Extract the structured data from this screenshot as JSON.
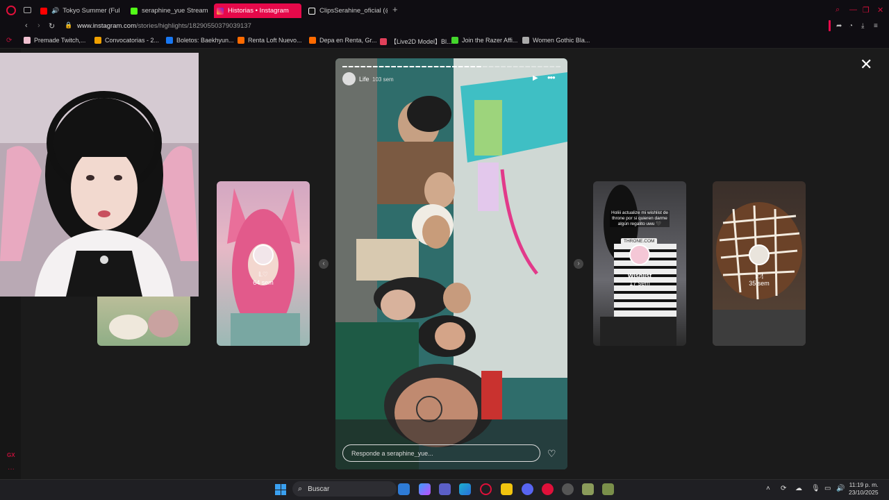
{
  "browser": {
    "tabs": [
      {
        "label": "Tokyo Summer (Full A",
        "active": false,
        "icon": "youtube-icon",
        "icon_color": "#ff0000"
      },
      {
        "label": "seraphine_yue Stream - W",
        "active": false,
        "icon": "kick-icon",
        "icon_color": "#53fc18"
      },
      {
        "label": "Historias • Instagram",
        "active": true,
        "icon": "instagram-icon",
        "icon_color": "#e1306c"
      },
      {
        "label": "ClipsSerahine_oficial (@c",
        "active": false,
        "icon": "tiktok-icon",
        "icon_color": "#ffffff"
      }
    ],
    "new_tab": "+",
    "url_host": "www.instagram.com",
    "url_path": "/stories/highlights/18290550379039137",
    "bookmarks": [
      {
        "label": "Premade Twitch,...",
        "icon_color": "#f0c0d0"
      },
      {
        "label": "Convocatorias - 2...",
        "icon_color": "#f0a000"
      },
      {
        "label": "Boletos: Baekhyun...",
        "icon_color": "#1877f2"
      },
      {
        "label": "Renta Loft Nuevo...",
        "icon_color": "#ff6a00"
      },
      {
        "label": "Depa en Renta, Gr...",
        "icon_color": "#ff6a00"
      },
      {
        "label": "【Live2D Model】Bl...",
        "icon_color": "#e0405a"
      },
      {
        "label": "Join the Razer Affi...",
        "icon_color": "#44d62c"
      },
      {
        "label": "Women Gothic Bla...",
        "icon_color": "#aaaaaa"
      }
    ]
  },
  "sidebar": {
    "gx_label": "GX",
    "more": "···"
  },
  "story_viewer": {
    "close": "✕",
    "prev_arrow": "‹",
    "next_arrow": "›",
    "thumbnails": [
      {
        "title": "",
        "time": ""
      },
      {
        "title": "𝕃♡",
        "time": "64 sem"
      },
      {
        "title": "Wishlist",
        "time": "17 sem",
        "caption": "Holiii actualize mi wishlist de throne por si quieren darme algún regalito uwu 🖤",
        "link": "THRONE.COM"
      },
      {
        "title": "🍽",
        "time": "35 sem"
      }
    ],
    "active_story": {
      "name": "Life",
      "time": "103 sem",
      "reply_placeholder": "Responde a seraphine_yue...",
      "progress_segments": 36,
      "progress_active_index": 22
    }
  },
  "taskbar": {
    "search_label": "Buscar",
    "time": "11:19 p. m.",
    "date": "23/10/2025"
  }
}
